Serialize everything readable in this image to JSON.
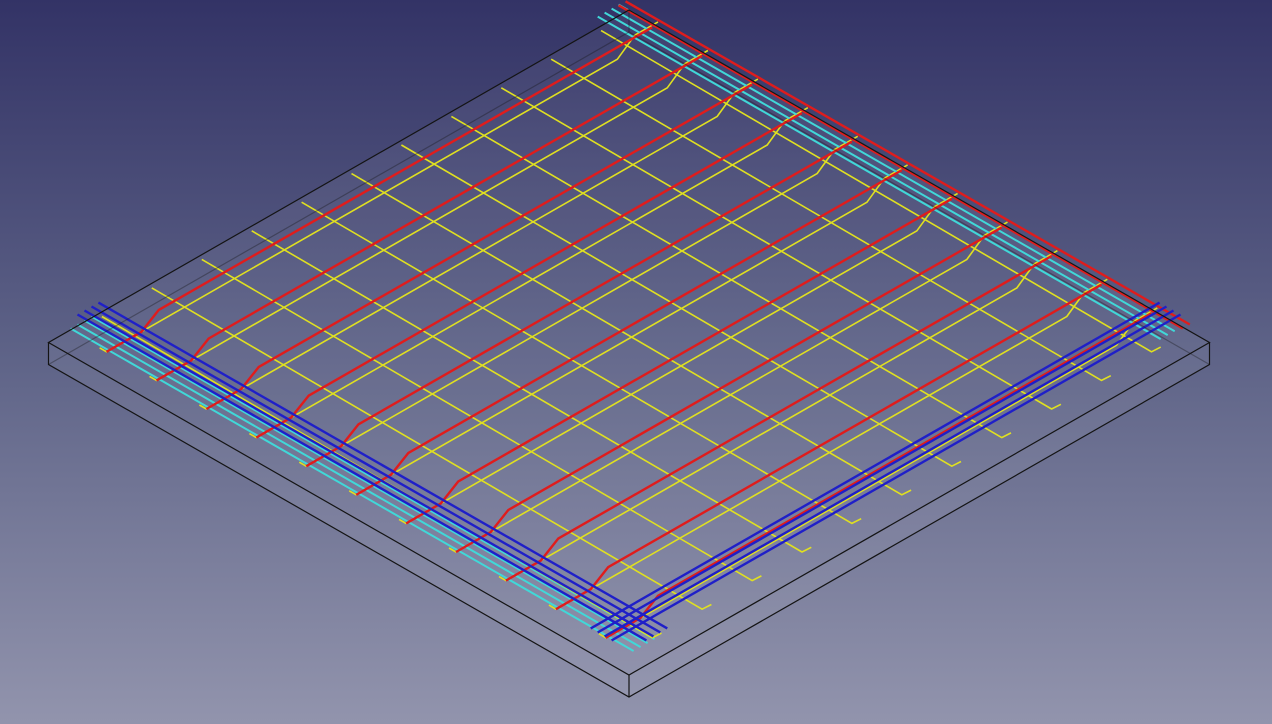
{
  "viewport": {
    "background_top": "#333366",
    "background_bottom": "#9294ad"
  },
  "model": {
    "type": "reinforced-concrete-slab",
    "projection": "isometric",
    "display_mode": "wireframe-transparent",
    "bars_per_direction": 11,
    "edge_layers": 4,
    "colors": {
      "outline": "#141414",
      "top_bars_x": "#e01c1c",
      "top_bars_y": "#1f1fc8",
      "bottom_bars_x": "#e0e020",
      "bottom_bars_y": "#40d8d8"
    }
  }
}
